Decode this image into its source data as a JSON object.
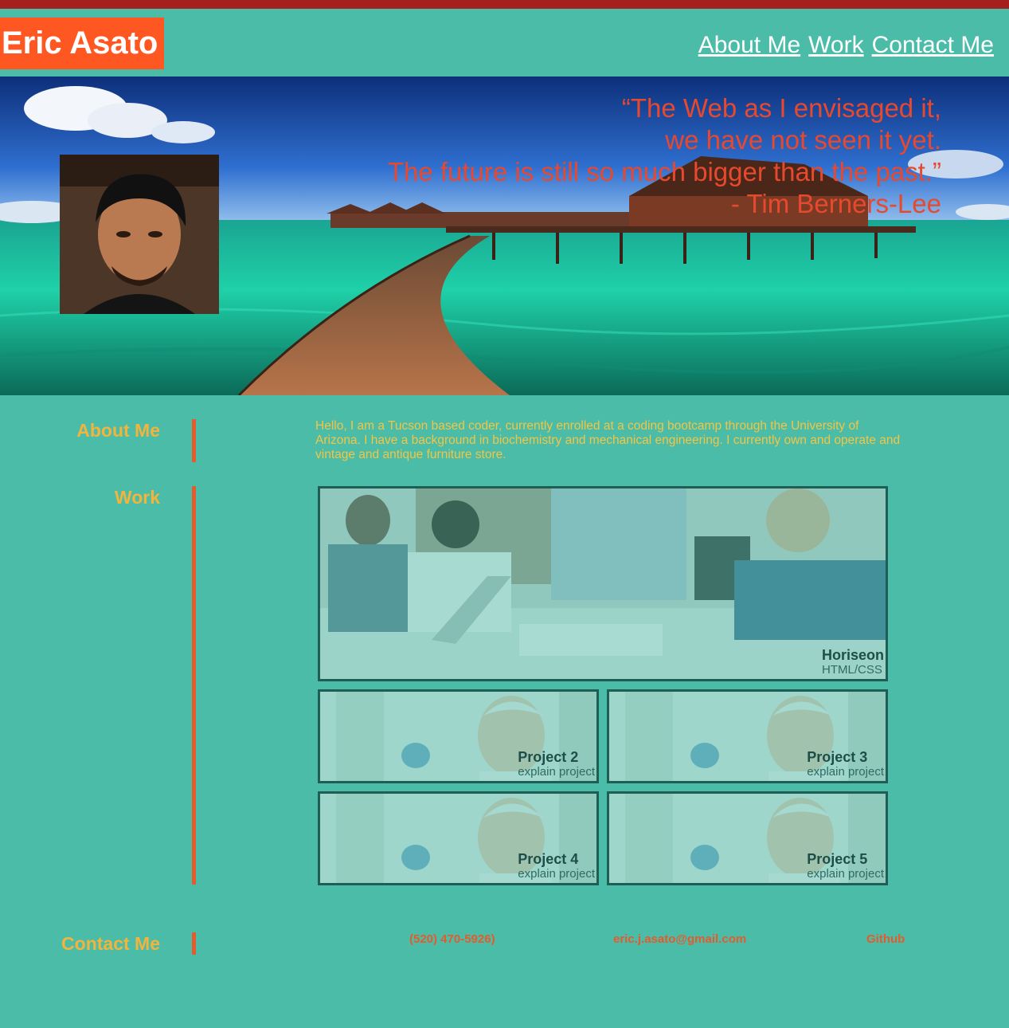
{
  "header": {
    "brand": "Eric Asato",
    "nav": [
      "About Me",
      "Work",
      "Contact Me"
    ]
  },
  "hero": {
    "quote_lines": [
      "“The Web as I envisaged it,",
      "we have not seen it yet.",
      "The future is still so much bigger than the past.”",
      "- Tim Berners-Lee"
    ]
  },
  "about": {
    "label": "About Me",
    "text": "Hello, I am a Tucson based coder, currently enrolled at a coding bootcamp through the University of Arizona. I have a background in biochemistry and mechanical engineering. I currently own and operate and vintage and antique furniture store."
  },
  "work": {
    "label": "Work",
    "featured": {
      "title": "Horiseon",
      "subtitle": "HTML/CSS"
    },
    "projects": [
      {
        "title": "Project 2",
        "subtitle": "explain project"
      },
      {
        "title": "Project 3",
        "subtitle": "explain project"
      },
      {
        "title": "Project 4",
        "subtitle": "explain project"
      },
      {
        "title": "Project 5",
        "subtitle": "explain project"
      }
    ]
  },
  "contact": {
    "label": "Contact Me",
    "phone": "(520) 470-5926)",
    "email": "eric.j.asato@gmail.com",
    "github": "Github"
  },
  "colors": {
    "page_bg": "#4bbca8",
    "brand_bg": "#ff5722",
    "top_bar": "#a51f1f",
    "section_label": "#f2b43c",
    "accent_bar": "#e55b2b"
  }
}
